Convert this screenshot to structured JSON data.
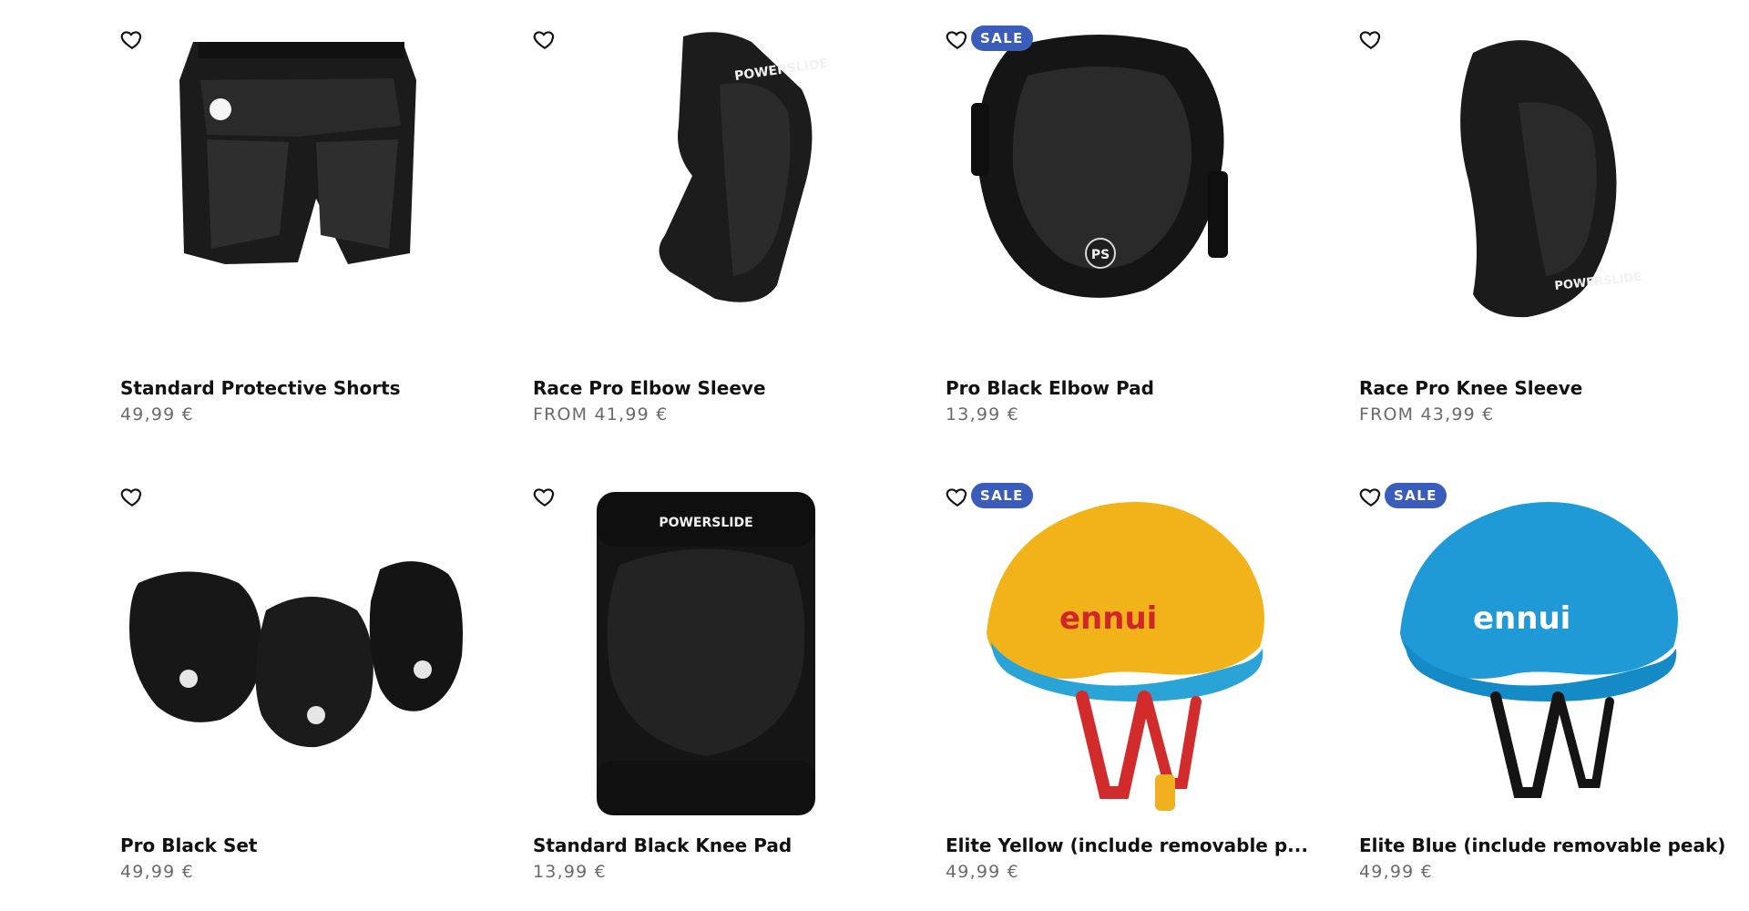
{
  "products": [
    {
      "title": "Standard Protective Shorts",
      "price": "49,99 €",
      "sale_badge": ""
    },
    {
      "title": "Race Pro Elbow Sleeve",
      "price": "FROM 41,99 €",
      "sale_badge": ""
    },
    {
      "title": "Pro Black Elbow Pad",
      "price": "13,99 €",
      "sale_badge": "SALE"
    },
    {
      "title": "Race Pro Knee Sleeve",
      "price": "FROM 43,99 €",
      "sale_badge": ""
    },
    {
      "title": "Pro Black Set",
      "price": "49,99 €",
      "sale_badge": ""
    },
    {
      "title": "Standard Black Knee Pad",
      "price": "13,99 €",
      "sale_badge": ""
    },
    {
      "title": "Elite Yellow (include removable p...",
      "price": "49,99 €",
      "sale_badge": "SALE"
    },
    {
      "title": "Elite Blue (include removable peak)",
      "price": "49,99 €",
      "sale_badge": "SALE"
    }
  ],
  "brand_marks": {
    "powerslide": "POWERSLIDE",
    "ps": "PS",
    "ennui": "ennui"
  },
  "icons": {
    "favorite": "heart-outline-icon"
  },
  "colors": {
    "sale_badge_bg": "#3a5cba",
    "price_text": "#6a6a6a",
    "title_text": "#111111",
    "helmet_yellow": "#f2b31a",
    "helmet_blue": "#1f9ad6",
    "ennui_red": "#d0262b"
  }
}
